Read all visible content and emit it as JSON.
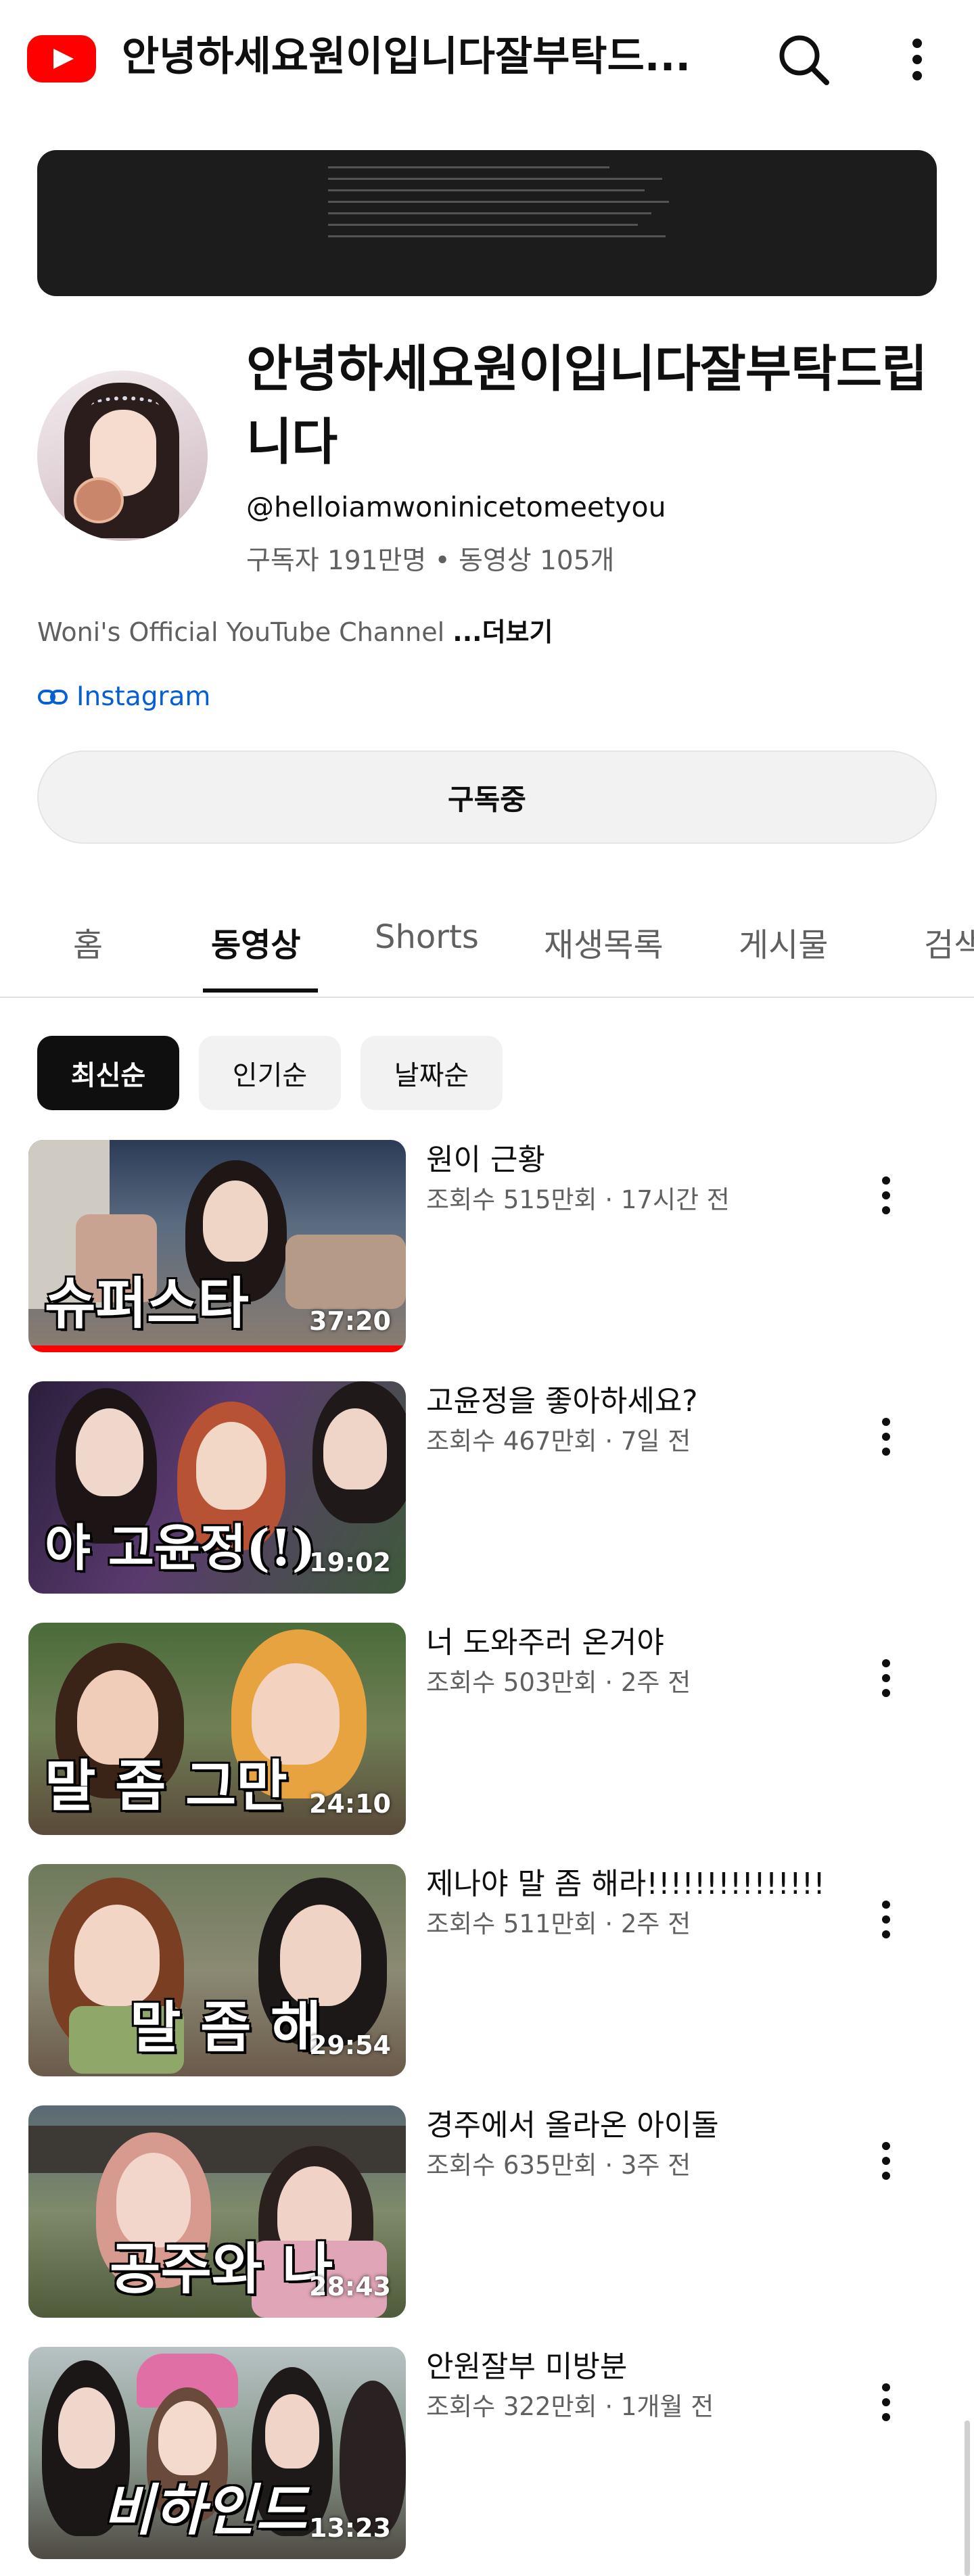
{
  "header": {
    "title": "안녕하세요원이입니다잘부탁드...",
    "search_icon": "search-icon",
    "more_icon": "more-vert-icon"
  },
  "channel": {
    "name": "안녕하세요원이입니다잘부탁드립니다",
    "handle": "@helloiamwoninicetomeetyou",
    "meta": "구독자 191만명 • 동영상 105개",
    "description": "Woni's Official YouTube Channel ",
    "description_more": "...더보기",
    "link_label": "Instagram",
    "subscribe_label": "구독중"
  },
  "tabs": [
    {
      "label": "홈"
    },
    {
      "label": "동영상"
    },
    {
      "label": "Shorts"
    },
    {
      "label": "재생목록"
    },
    {
      "label": "게시물"
    },
    {
      "label": "검색"
    }
  ],
  "filters": [
    {
      "label": "최신순"
    },
    {
      "label": "인기순"
    },
    {
      "label": "날짜순"
    }
  ],
  "videos": [
    {
      "title": "원이 근황",
      "meta": "조회수 515만회 · 17시간 전",
      "duration": "37:20",
      "thumb_text": "슈퍼스타",
      "watched_fraction": 1.0
    },
    {
      "title": "고윤정을 좋아하세요?",
      "meta": "조회수 467만회 · 7일 전",
      "duration": "19:02",
      "thumb_text": "야 고윤정(!)",
      "watched_fraction": 0
    },
    {
      "title": "너 도와주러 온거야",
      "meta": "조회수 503만회 · 2주 전",
      "duration": "24:10",
      "thumb_text": "말 좀 그만",
      "watched_fraction": 0
    },
    {
      "title": "제나야 말 좀 해라!!!!!!!!!!!!!!!",
      "meta": "조회수 511만회 · 2주 전",
      "duration": "29:54",
      "thumb_text": "말 좀 해",
      "watched_fraction": 0
    },
    {
      "title": "경주에서 올라온 아이돌",
      "meta": "조회수 635만회 · 3주 전",
      "duration": "28:43",
      "thumb_text": "공주와 나",
      "watched_fraction": 0
    },
    {
      "title": "안원잘부 미방분",
      "meta": "조회수 322만회 · 1개월 전",
      "duration": "13:23",
      "thumb_text": "비하인드",
      "watched_fraction": 0
    }
  ],
  "colors": {
    "brand_red": "#ff0000",
    "link_blue": "#065fd4",
    "secondary_text": "#606060"
  }
}
